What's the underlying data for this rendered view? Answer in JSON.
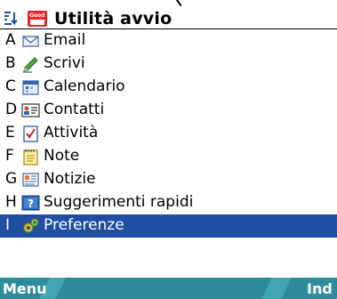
{
  "title": {
    "text": "Utilità avvio",
    "app_icon_text": "Good"
  },
  "list": [
    {
      "key": "A",
      "label": "Email",
      "icon": "email-icon"
    },
    {
      "key": "B",
      "label": "Scrivi",
      "icon": "compose-icon"
    },
    {
      "key": "C",
      "label": "Calendario",
      "icon": "calendar-icon"
    },
    {
      "key": "D",
      "label": "Contatti",
      "icon": "contacts-icon"
    },
    {
      "key": "E",
      "label": "Attività",
      "icon": "tasks-icon"
    },
    {
      "key": "F",
      "label": "Note",
      "icon": "notes-icon"
    },
    {
      "key": "G",
      "label": "Notizie",
      "icon": "news-icon"
    },
    {
      "key": "H",
      "label": "Suggerimenti rapidi",
      "icon": "help-icon"
    },
    {
      "key": "I",
      "label": "Preferenze",
      "icon": "preferences-icon",
      "selected": true
    }
  ],
  "softkeys": {
    "left": "Menu",
    "right": "Ind"
  },
  "colors": {
    "selection": "#1e4fa3",
    "softkey_bar": "#2e8c9a",
    "accent_red": "#e8242a"
  }
}
